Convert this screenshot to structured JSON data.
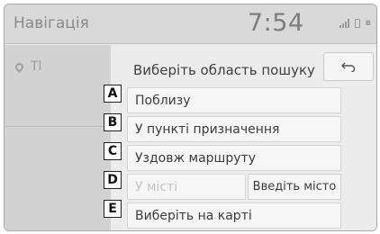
{
  "header": {
    "title": "Навігація",
    "time": "7:54",
    "status_icons": [
      "signal-strength-icon",
      "phone-icon",
      "bluetooth-icon"
    ]
  },
  "sidebar": {
    "item_label": "Tl",
    "item_icon": "location-pin-icon"
  },
  "panel": {
    "title": "Виберіть область пошуку",
    "back_icon": "back-arrow-icon",
    "options": [
      {
        "label": "Поблизу",
        "enabled": true
      },
      {
        "label": "У пункті призначення",
        "enabled": true
      },
      {
        "label": "Уздовж маршруту",
        "enabled": true
      },
      {
        "label": "У місті",
        "enabled": false
      },
      {
        "label": "Виберіть на карті",
        "enabled": true
      }
    ],
    "enter_city_label": "Введіть місто"
  },
  "callouts": [
    "A",
    "B",
    "C",
    "D",
    "E"
  ]
}
